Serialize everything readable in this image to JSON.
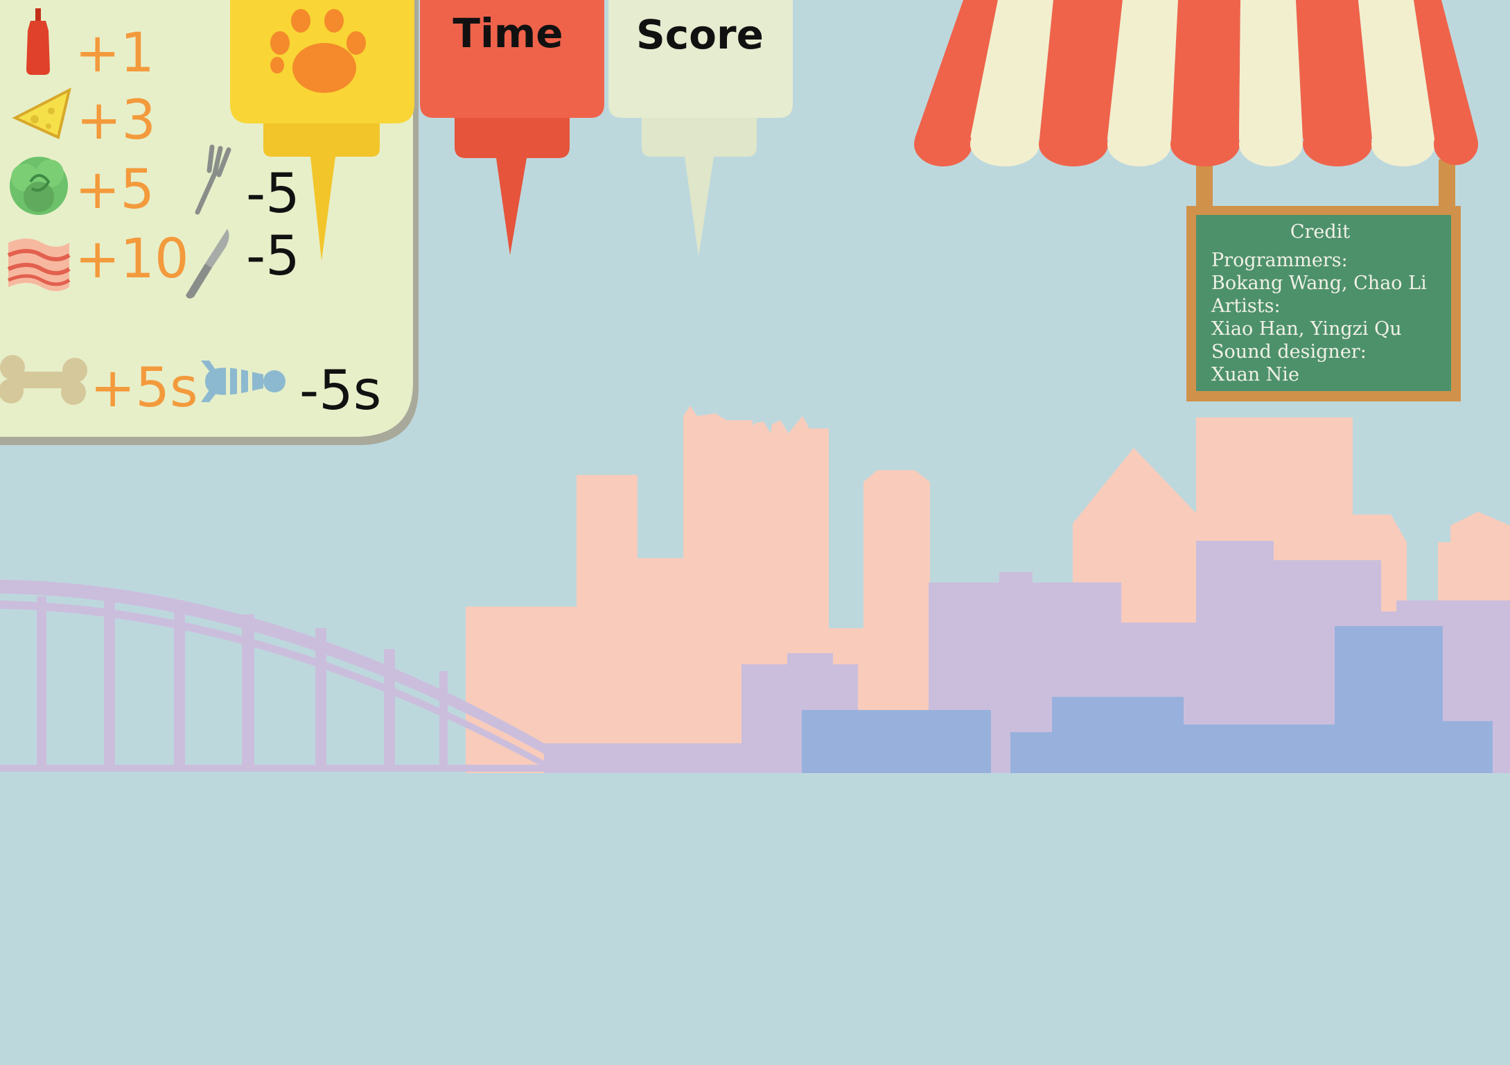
{
  "legend": {
    "items": [
      {
        "icon": "ketchup-bottle-icon",
        "value": "+1"
      },
      {
        "icon": "cheese-icon",
        "value": "+3"
      },
      {
        "icon": "lettuce-icon",
        "value": "+5"
      },
      {
        "icon": "bacon-icon",
        "value": "+10"
      },
      {
        "icon": "fork-icon",
        "value": "-5"
      },
      {
        "icon": "knife-icon",
        "value": "-5"
      },
      {
        "icon": "bone-icon",
        "value": "+5s"
      },
      {
        "icon": "fishbone-icon",
        "value": "-5s"
      }
    ]
  },
  "bottles": {
    "paw": {
      "icon": "paw-icon",
      "color": "#f9d535"
    },
    "time": {
      "label": "Time",
      "color": "#ef634b"
    },
    "score": {
      "label": "Score",
      "color": "#e6ecd0"
    }
  },
  "credit": {
    "title": "Credit",
    "lines": [
      "Programmers:",
      "Bokang Wang, Chao Li",
      "Artists:",
      "Xiao Han, Yingzi Qu",
      "Sound designer:",
      "Xuan Nie"
    ]
  },
  "colors": {
    "sky": "#bdd8dd",
    "building_peach": "#f8cbbb",
    "building_purple": "#cbbedd",
    "building_blue": "#97b1dc",
    "awning_red": "#ef634b",
    "awning_cream": "#f2efcf",
    "board_green": "#4d916b",
    "board_frame": "#d0924a"
  }
}
